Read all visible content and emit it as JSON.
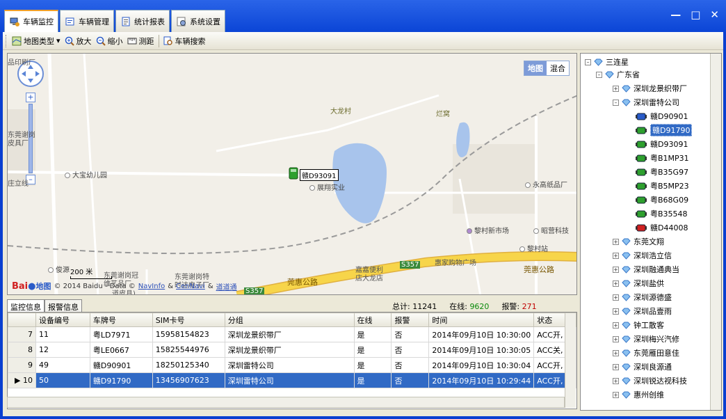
{
  "tabs": [
    {
      "label": "车辆监控",
      "icon": "monitor-icon",
      "active": true
    },
    {
      "label": "车辆管理",
      "icon": "vehicle-manage-icon",
      "active": false
    },
    {
      "label": "统计报表",
      "icon": "report-icon",
      "active": false
    },
    {
      "label": "系统设置",
      "icon": "settings-icon",
      "active": false
    }
  ],
  "toolbar": {
    "map_type": "地图类型",
    "zoom_in": "放大",
    "zoom_out": "缩小",
    "measure": "测距",
    "vehicle_search": "车辆搜索"
  },
  "map": {
    "type_map": "地图",
    "type_hybrid": "混合",
    "labels": {
      "dalong": "大龙村",
      "lanwo": "烂窝",
      "dabao": "大宝幼儿园",
      "zhanxiang": "展翔实业",
      "yonggao": "永高纸品厂",
      "licun_market": "黎村新市场",
      "zhaoying": "昭营科技",
      "licun_station": "黎村站",
      "huijia": "惠家购物广场",
      "jiajia": "嘉嘉便利",
      "jiajia2": "店大龙店",
      "junyuan": "俊源",
      "xiegang1": "东莞谢岗冠",
      "xiegang1b": "维艺品厂",
      "xiegang2": "东莞谢岗特",
      "xiegang2b": "时达电子厂",
      "huihui_road": "莞惠公路",
      "huihui_road2": "莞惠公路",
      "s357": "S357",
      "s357b": "S357",
      "pinyinchang": "品印刷厂",
      "dongguan_xie": "东莞谢岗",
      "pipin": "皮具厂",
      "zhuli": "庄立线",
      "yinkou": "道皮具)"
    },
    "vehicle_label": "赣D93091",
    "scale": "200 米",
    "copyright": "© 2014 Baidu - Data ©",
    "navinfo": "NavInfo",
    "amp1": "&",
    "cennavi": "CenNavi",
    "amp2": "&",
    "daodao": "道道通",
    "baidu": "Bai",
    "baidu2": "地图"
  },
  "bottom": {
    "tab_monitor": "监控信息",
    "tab_alarm": "报警信息",
    "total_label": "总计:",
    "total_value": "11241",
    "online_label": "在线:",
    "online_value": "9620",
    "alarm_label": "报警:",
    "alarm_value": "271"
  },
  "grid": {
    "headers": [
      "设备编号",
      "车牌号",
      "SIM卡号",
      "分组",
      "在线",
      "报警",
      "时间",
      "状态"
    ],
    "rows": [
      {
        "num": "7",
        "cells": [
          "11",
          "粤LD7971",
          "15958154823",
          "深圳龙景织带厂",
          "是",
          "否",
          "2014年09月10日 10:30:00",
          "ACC开, 定"
        ],
        "selected": false
      },
      {
        "num": "8",
        "cells": [
          "12",
          "粤LE0667",
          "15825544976",
          "深圳龙景织带厂",
          "是",
          "否",
          "2014年09月10日 10:30:05",
          "ACC关, 定"
        ],
        "selected": false
      },
      {
        "num": "9",
        "cells": [
          "49",
          "赣D90901",
          "18250125340",
          "深圳雷特公司",
          "是",
          "否",
          "2014年09月10日 10:30:04",
          "ACC开, 定"
        ],
        "selected": false
      },
      {
        "num": "10",
        "cells": [
          "50",
          "赣D91790",
          "13456907623",
          "深圳雷特公司",
          "是",
          "否",
          "2014年09月10日 10:29:44",
          "ACC开, 定"
        ],
        "selected": true
      }
    ]
  },
  "tree": {
    "root": "三连星",
    "province": "广东省",
    "groups_top": [
      "深圳龙景织带厂"
    ],
    "open_group": "深圳雷特公司",
    "vehicles": [
      {
        "plate": "赣D90901",
        "status": "blue",
        "selected": false
      },
      {
        "plate": "赣D91790",
        "status": "green",
        "selected": true
      },
      {
        "plate": "赣D93091",
        "status": "green",
        "selected": false
      },
      {
        "plate": "粤B1MP31",
        "status": "green",
        "selected": false
      },
      {
        "plate": "粤B35G97",
        "status": "green",
        "selected": false
      },
      {
        "plate": "粤B5MP23",
        "status": "green",
        "selected": false
      },
      {
        "plate": "粤B68G09",
        "status": "green",
        "selected": false
      },
      {
        "plate": "粤B35548",
        "status": "green",
        "selected": false
      },
      {
        "plate": "赣D44008",
        "status": "red",
        "selected": false
      }
    ],
    "groups_bottom": [
      "东莞文翔",
      "深圳浩立信",
      "深圳融通典当",
      "深圳盐供",
      "深圳源德盛",
      "深圳品壹雨",
      "钟工散客",
      "深圳梅兴汽修",
      "东莞雁田意佳",
      "深圳良源通",
      "深圳锐达视科技",
      "惠州创维"
    ]
  },
  "colors": {
    "titlebar": "#0b45d6",
    "accent_tab": "#f0a02a",
    "selection": "#316ac5",
    "online": "#0a8a0a",
    "alarm": "#c00000",
    "road": "#f5c842",
    "lake": "#a8c4ec"
  }
}
